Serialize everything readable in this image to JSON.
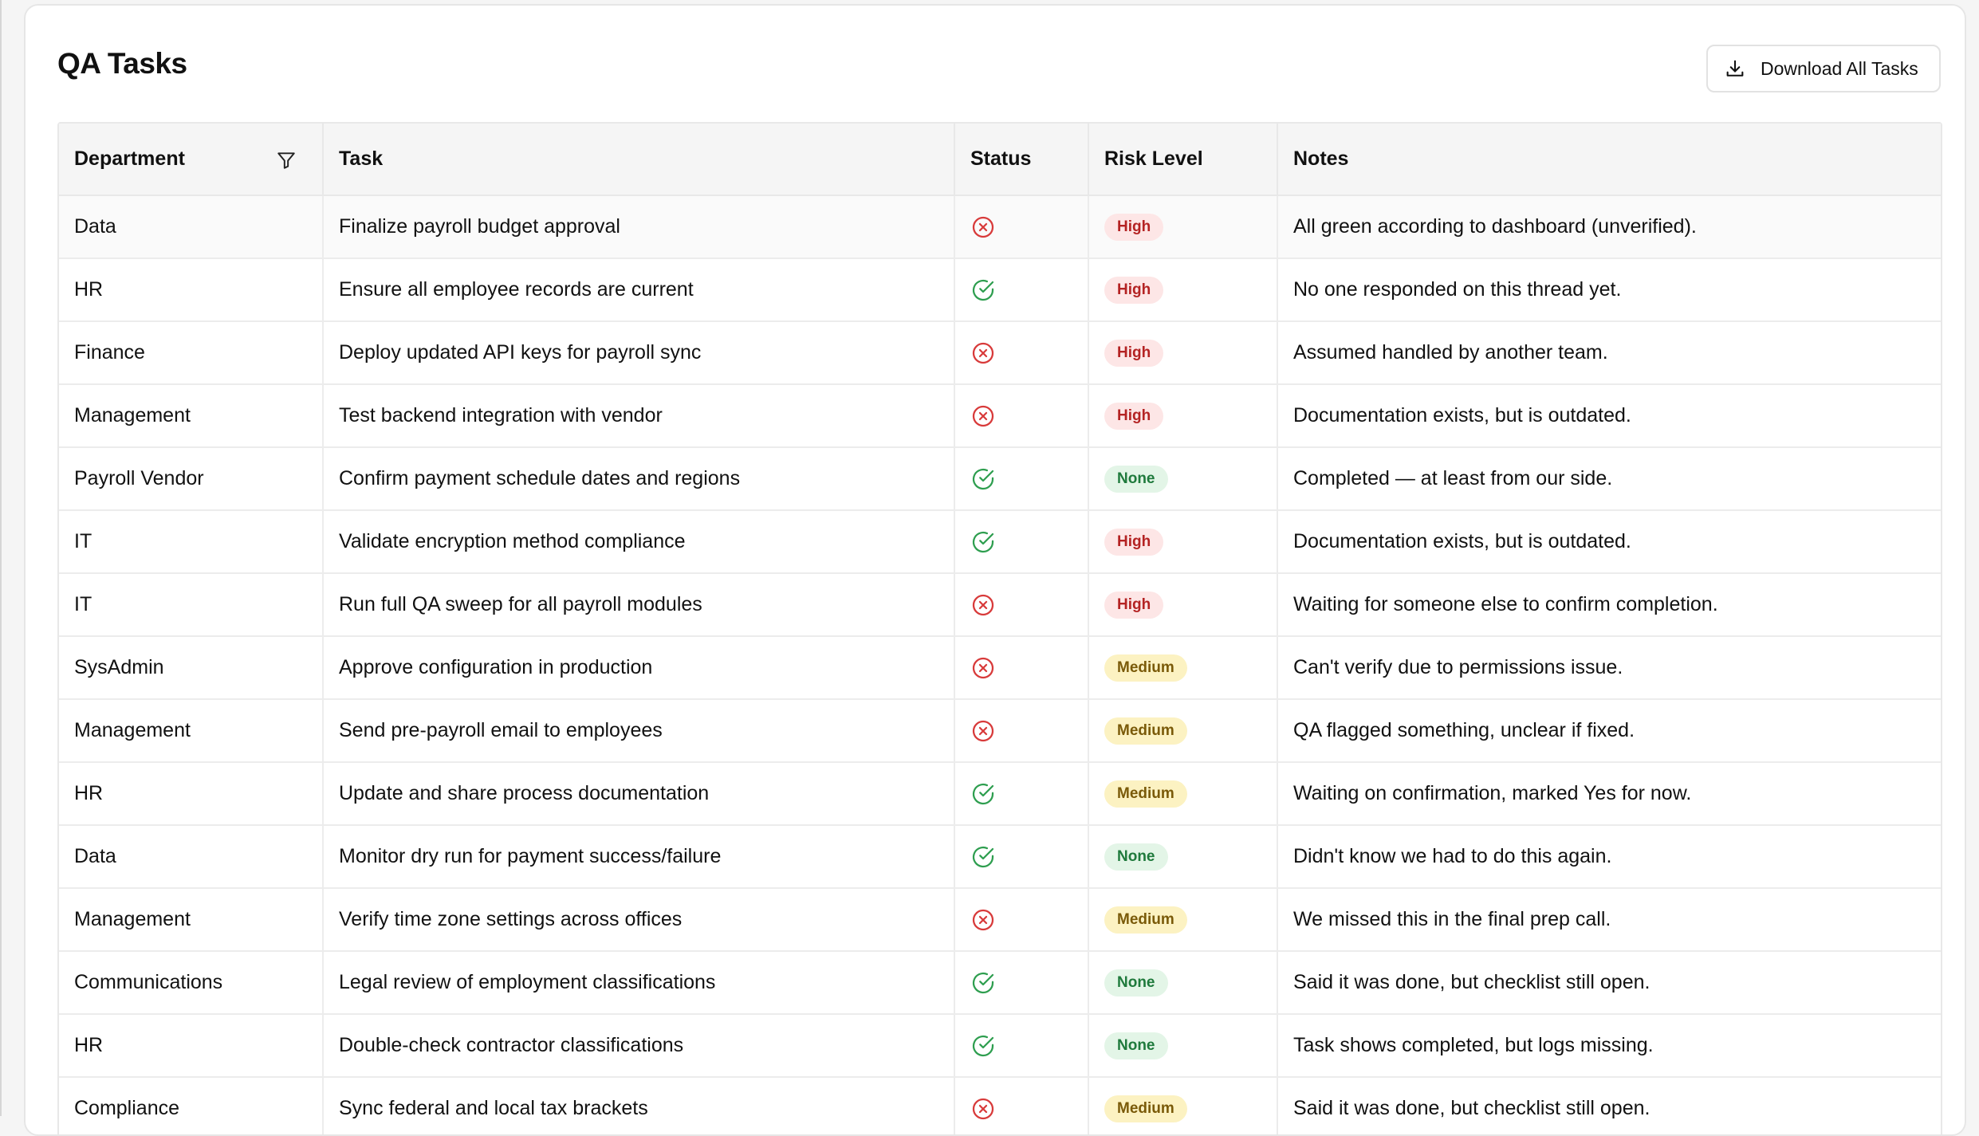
{
  "page": {
    "title": "QA Tasks",
    "download_label": "Download All Tasks"
  },
  "columns": [
    "Department",
    "Task",
    "Status",
    "Risk Level",
    "Notes"
  ],
  "colors": {
    "status_done": "#2e9e4f",
    "status_failed": "#d83a3a",
    "risk_high_bg": "#fde6e6",
    "risk_medium_bg": "#fcf2c2",
    "risk_none_bg": "#e3f5e7"
  },
  "rows": [
    {
      "department": "Data",
      "task": "Finalize payroll budget approval",
      "status": "failed",
      "risk": "High",
      "notes": "All green according to dashboard (unverified)."
    },
    {
      "department": "HR",
      "task": "Ensure all employee records are current",
      "status": "done",
      "risk": "High",
      "notes": "No one responded on this thread yet."
    },
    {
      "department": "Finance",
      "task": "Deploy updated API keys for payroll sync",
      "status": "failed",
      "risk": "High",
      "notes": "Assumed handled by another team."
    },
    {
      "department": "Management",
      "task": "Test backend integration with vendor",
      "status": "failed",
      "risk": "High",
      "notes": "Documentation exists, but is outdated."
    },
    {
      "department": "Payroll Vendor",
      "task": "Confirm payment schedule dates and regions",
      "status": "done",
      "risk": "None",
      "notes": "Completed — at least from our side."
    },
    {
      "department": "IT",
      "task": "Validate encryption method compliance",
      "status": "done",
      "risk": "High",
      "notes": "Documentation exists, but is outdated."
    },
    {
      "department": "IT",
      "task": "Run full QA sweep for all payroll modules",
      "status": "failed",
      "risk": "High",
      "notes": "Waiting for someone else to confirm completion."
    },
    {
      "department": "SysAdmin",
      "task": "Approve configuration in production",
      "status": "failed",
      "risk": "Medium",
      "notes": "Can't verify due to permissions issue."
    },
    {
      "department": "Management",
      "task": "Send pre-payroll email to employees",
      "status": "failed",
      "risk": "Medium",
      "notes": "QA flagged something, unclear if fixed."
    },
    {
      "department": "HR",
      "task": "Update and share process documentation",
      "status": "done",
      "risk": "Medium",
      "notes": "Waiting on confirmation, marked Yes for now."
    },
    {
      "department": "Data",
      "task": "Monitor dry run for payment success/failure",
      "status": "done",
      "risk": "None",
      "notes": "Didn't know we had to do this again."
    },
    {
      "department": "Management",
      "task": "Verify time zone settings across offices",
      "status": "failed",
      "risk": "Medium",
      "notes": "We missed this in the final prep call."
    },
    {
      "department": "Communications",
      "task": "Legal review of employment classifications",
      "status": "done",
      "risk": "None",
      "notes": "Said it was done, but checklist still open."
    },
    {
      "department": "HR",
      "task": "Double-check contractor classifications",
      "status": "done",
      "risk": "None",
      "notes": "Task shows completed, but logs missing."
    },
    {
      "department": "Compliance",
      "task": "Sync federal and local tax brackets",
      "status": "failed",
      "risk": "Medium",
      "notes": "Said it was done, but checklist still open."
    }
  ]
}
